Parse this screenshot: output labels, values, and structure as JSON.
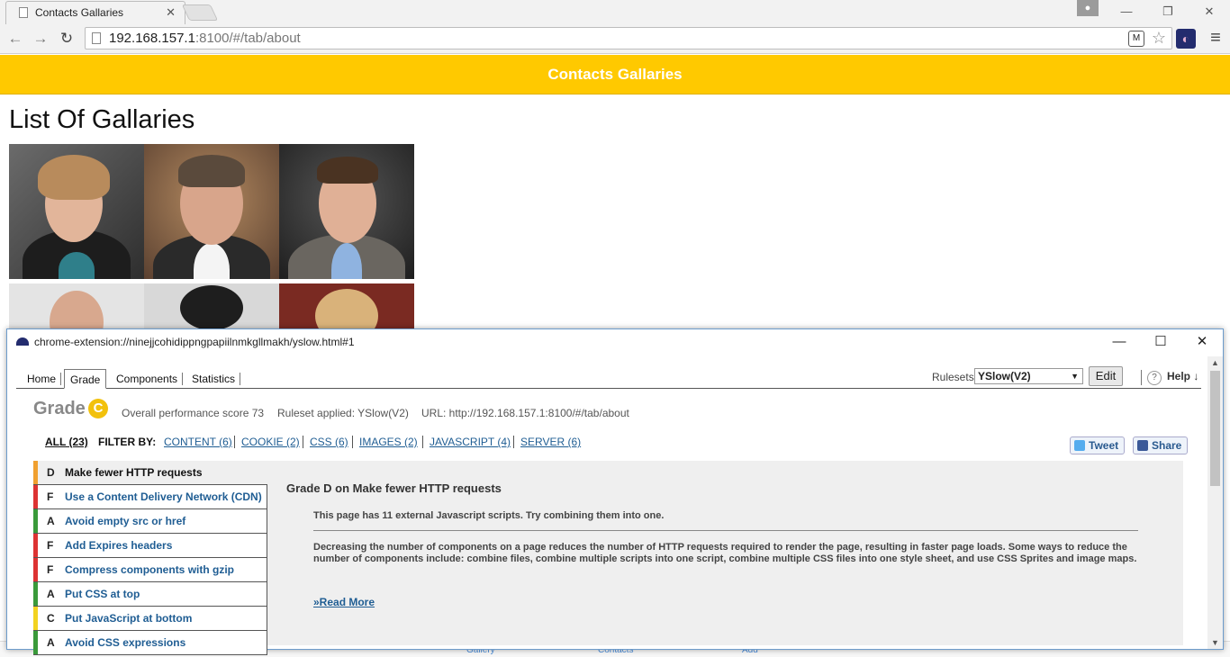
{
  "browser": {
    "tab_title": "Contacts Gallaries",
    "tab_close": "✕",
    "url_host": "192.168.157.1",
    "url_rest": ":8100/#/tab/about",
    "window_controls": [
      "—",
      "❐",
      "✕"
    ]
  },
  "app": {
    "header_title": "Contacts Gallaries",
    "page_title": "List Of Gallaries",
    "footer_tabs": [
      "Gallery",
      "Contacts",
      "Add"
    ]
  },
  "popup": {
    "title": "chrome-extension://ninejjcohidippngpapiilnmkgllmakh/yslow.html#1",
    "controls": [
      "—",
      "☐",
      "✕"
    ],
    "tabs": [
      "Home",
      "Grade",
      "Components",
      "Statistics"
    ],
    "active_tab": "Grade",
    "rulesets_label": "Rulesets",
    "ruleset_value": "YSlow(V2)",
    "edit_label": "Edit",
    "help_label": "Help ↓",
    "grade_word": "Grade",
    "grade_letter": "C",
    "grade_color": "#f2c10c",
    "score_text": "Overall performance score 73",
    "ruleset_text": "Ruleset applied: YSlow(V2)",
    "url_text": "URL: http://192.168.157.1:8100/#/tab/about",
    "filter_all": "ALL (23)",
    "filter_by": "FILTER BY:",
    "filters": [
      "CONTENT (6)",
      "COOKIE (2)",
      "CSS (6)",
      "IMAGES (2)",
      "JAVASCRIPT (4)",
      "SERVER (6)"
    ],
    "tweet_label": "Tweet",
    "share_label": "Share",
    "rules": [
      {
        "grade": "D",
        "text": "Make fewer HTTP requests",
        "color": "#f0a030"
      },
      {
        "grade": "F",
        "text": "Use a Content Delivery Network (CDN)",
        "color": "#d33"
      },
      {
        "grade": "A",
        "text": "Avoid empty src or href",
        "color": "#3a9a3a"
      },
      {
        "grade": "F",
        "text": "Add Expires headers",
        "color": "#d33"
      },
      {
        "grade": "F",
        "text": "Compress components with gzip",
        "color": "#d33"
      },
      {
        "grade": "A",
        "text": "Put CSS at top",
        "color": "#3a9a3a"
      },
      {
        "grade": "C",
        "text": "Put JavaScript at bottom",
        "color": "#f2d320"
      },
      {
        "grade": "A",
        "text": "Avoid CSS expressions",
        "color": "#3a9a3a"
      }
    ],
    "detail": {
      "heading": "Grade D on Make fewer HTTP requests",
      "summary": "This page has 11 external Javascript scripts. Try combining them into one.",
      "description": "Decreasing the number of components on a page reduces the number of HTTP requests required to render the page, resulting in faster page loads. Some ways to reduce the number of components include: combine files, combine multiple scripts into one script, combine multiple CSS files into one style sheet, and use CSS Sprites and image maps.",
      "read_more": "»Read More"
    }
  }
}
